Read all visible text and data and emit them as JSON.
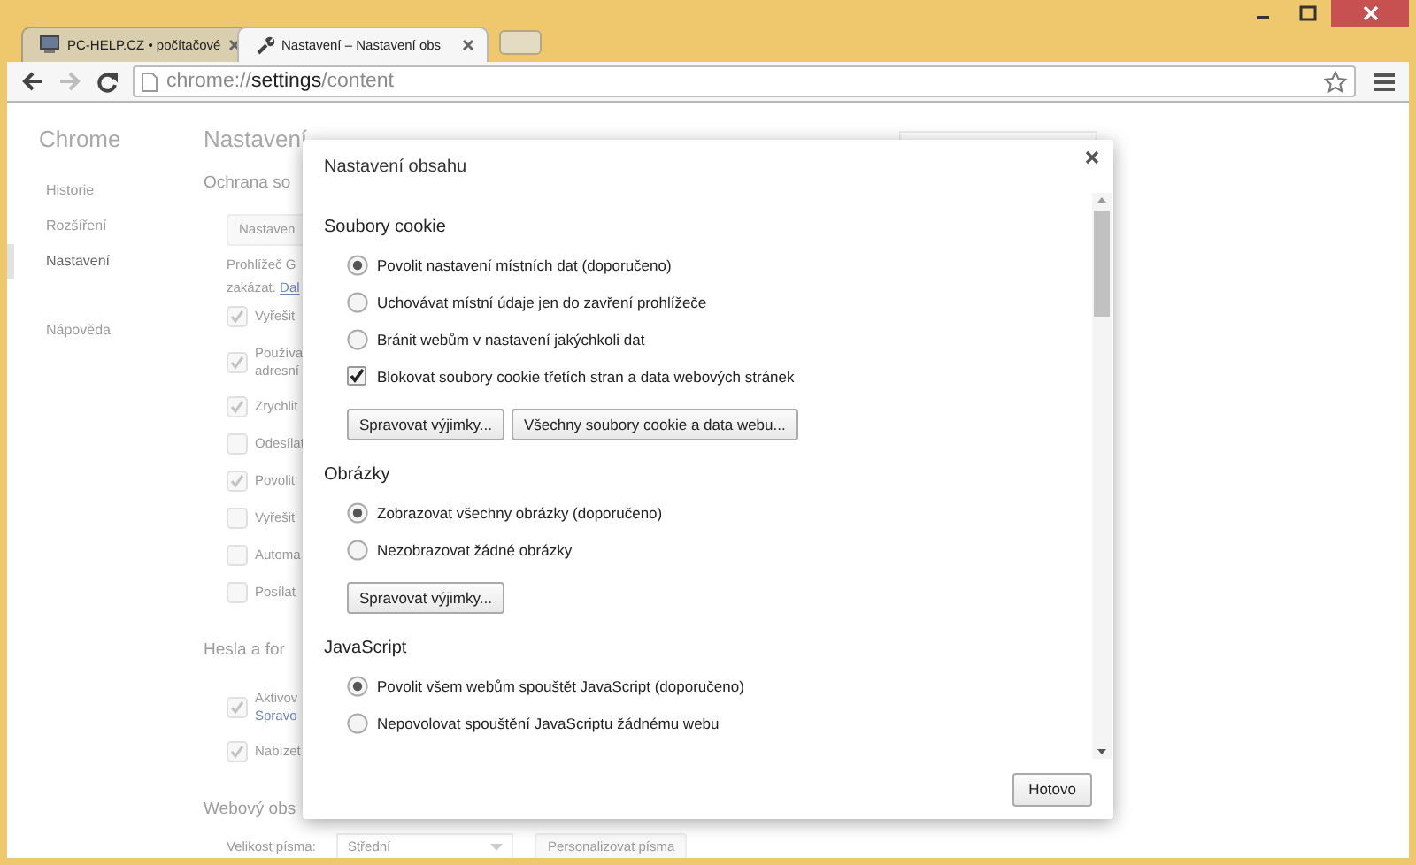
{
  "browser": {
    "tabs": [
      {
        "kind": "page",
        "title": "PC-HELP.CZ • počítačové",
        "selected": false
      },
      {
        "kind": "settings",
        "title": "Nastavení – Nastavení obs",
        "selected": true
      }
    ],
    "back_disabled": false,
    "forward_disabled": true,
    "address": [
      {
        "text": "chrome://",
        "strong": false
      },
      {
        "text": "settings",
        "strong": true
      },
      {
        "text": "/content",
        "strong": false
      }
    ]
  },
  "sidebar": {
    "title": "Chrome",
    "items": [
      {
        "label": "Historie",
        "selected": false
      },
      {
        "label": "Rozšíření",
        "selected": false
      },
      {
        "label": "Nastavení",
        "selected": true
      },
      {
        "label": "Nápověda",
        "selected": false
      }
    ]
  },
  "main": {
    "title": "Nastavení",
    "items": [
      {
        "kind": "heading",
        "text": "Ochrana so"
      },
      {
        "kind": "button",
        "text": "Nastaven"
      },
      {
        "kind": "paragraph",
        "line1": "Prohlížeč G",
        "line2": "zakázat.",
        "link": "Dal"
      },
      {
        "kind": "checkbox",
        "checked": true,
        "lines": [
          "Vyřešit"
        ]
      },
      {
        "kind": "checkbox",
        "checked": true,
        "lines": [
          "Používa",
          "adresní"
        ]
      },
      {
        "kind": "checkbox",
        "checked": true,
        "lines": [
          "Zrychlit"
        ]
      },
      {
        "kind": "checkbox",
        "checked": false,
        "lines": [
          "Odesílat"
        ]
      },
      {
        "kind": "checkbox",
        "checked": true,
        "lines": [
          "Povolit"
        ]
      },
      {
        "kind": "checkbox",
        "checked": false,
        "lines": [
          "Vyřešit"
        ]
      },
      {
        "kind": "checkbox",
        "checked": false,
        "lines": [
          "Automa"
        ]
      },
      {
        "kind": "checkbox",
        "checked": false,
        "lines": [
          "Posílat"
        ]
      },
      {
        "kind": "heading",
        "text": "Hesla a for"
      },
      {
        "kind": "checkbox",
        "checked": true,
        "lines": [
          "Aktivov"
        ],
        "link": "Spravo"
      },
      {
        "kind": "checkbox",
        "checked": true,
        "lines": [
          "Nabízet"
        ]
      },
      {
        "kind": "heading",
        "text": "Webový obs"
      },
      {
        "kind": "font-row",
        "label": "Velikost písma:",
        "select": "Střední",
        "button": "Personalizovat písma"
      }
    ]
  },
  "dialog": {
    "title": "Nastavení obsahu",
    "sections": [
      {
        "heading": "Soubory cookie",
        "options": [
          {
            "kind": "radio",
            "label": "Povolit nastavení místních dat (doporučeno)",
            "selected": true
          },
          {
            "kind": "radio",
            "label": "Uchovávat místní údaje jen do zavření prohlížeče",
            "selected": false
          },
          {
            "kind": "radio",
            "label": "Bránit webům v nastavení jakýchkoli dat",
            "selected": false
          },
          {
            "kind": "checkbox",
            "label": "Blokovat soubory cookie třetích stran a data webových stránek",
            "checked": true
          }
        ],
        "buttons": [
          "Spravovat výjimky...",
          "Všechny soubory cookie a data webu..."
        ]
      },
      {
        "heading": "Obrázky",
        "options": [
          {
            "kind": "radio",
            "label": "Zobrazovat všechny obrázky (doporučeno)",
            "selected": true
          },
          {
            "kind": "radio",
            "label": "Nezobrazovat žádné obrázky",
            "selected": false
          }
        ],
        "buttons": [
          "Spravovat výjimky..."
        ]
      },
      {
        "heading": "JavaScript",
        "options": [
          {
            "kind": "radio",
            "label": "Povolit všem webům spouštět JavaScript (doporučeno)",
            "selected": true
          },
          {
            "kind": "radio",
            "label": "Nepovolovat spouštění JavaScriptu žádnému webu",
            "selected": false
          }
        ]
      }
    ],
    "done": "Hotovo"
  }
}
